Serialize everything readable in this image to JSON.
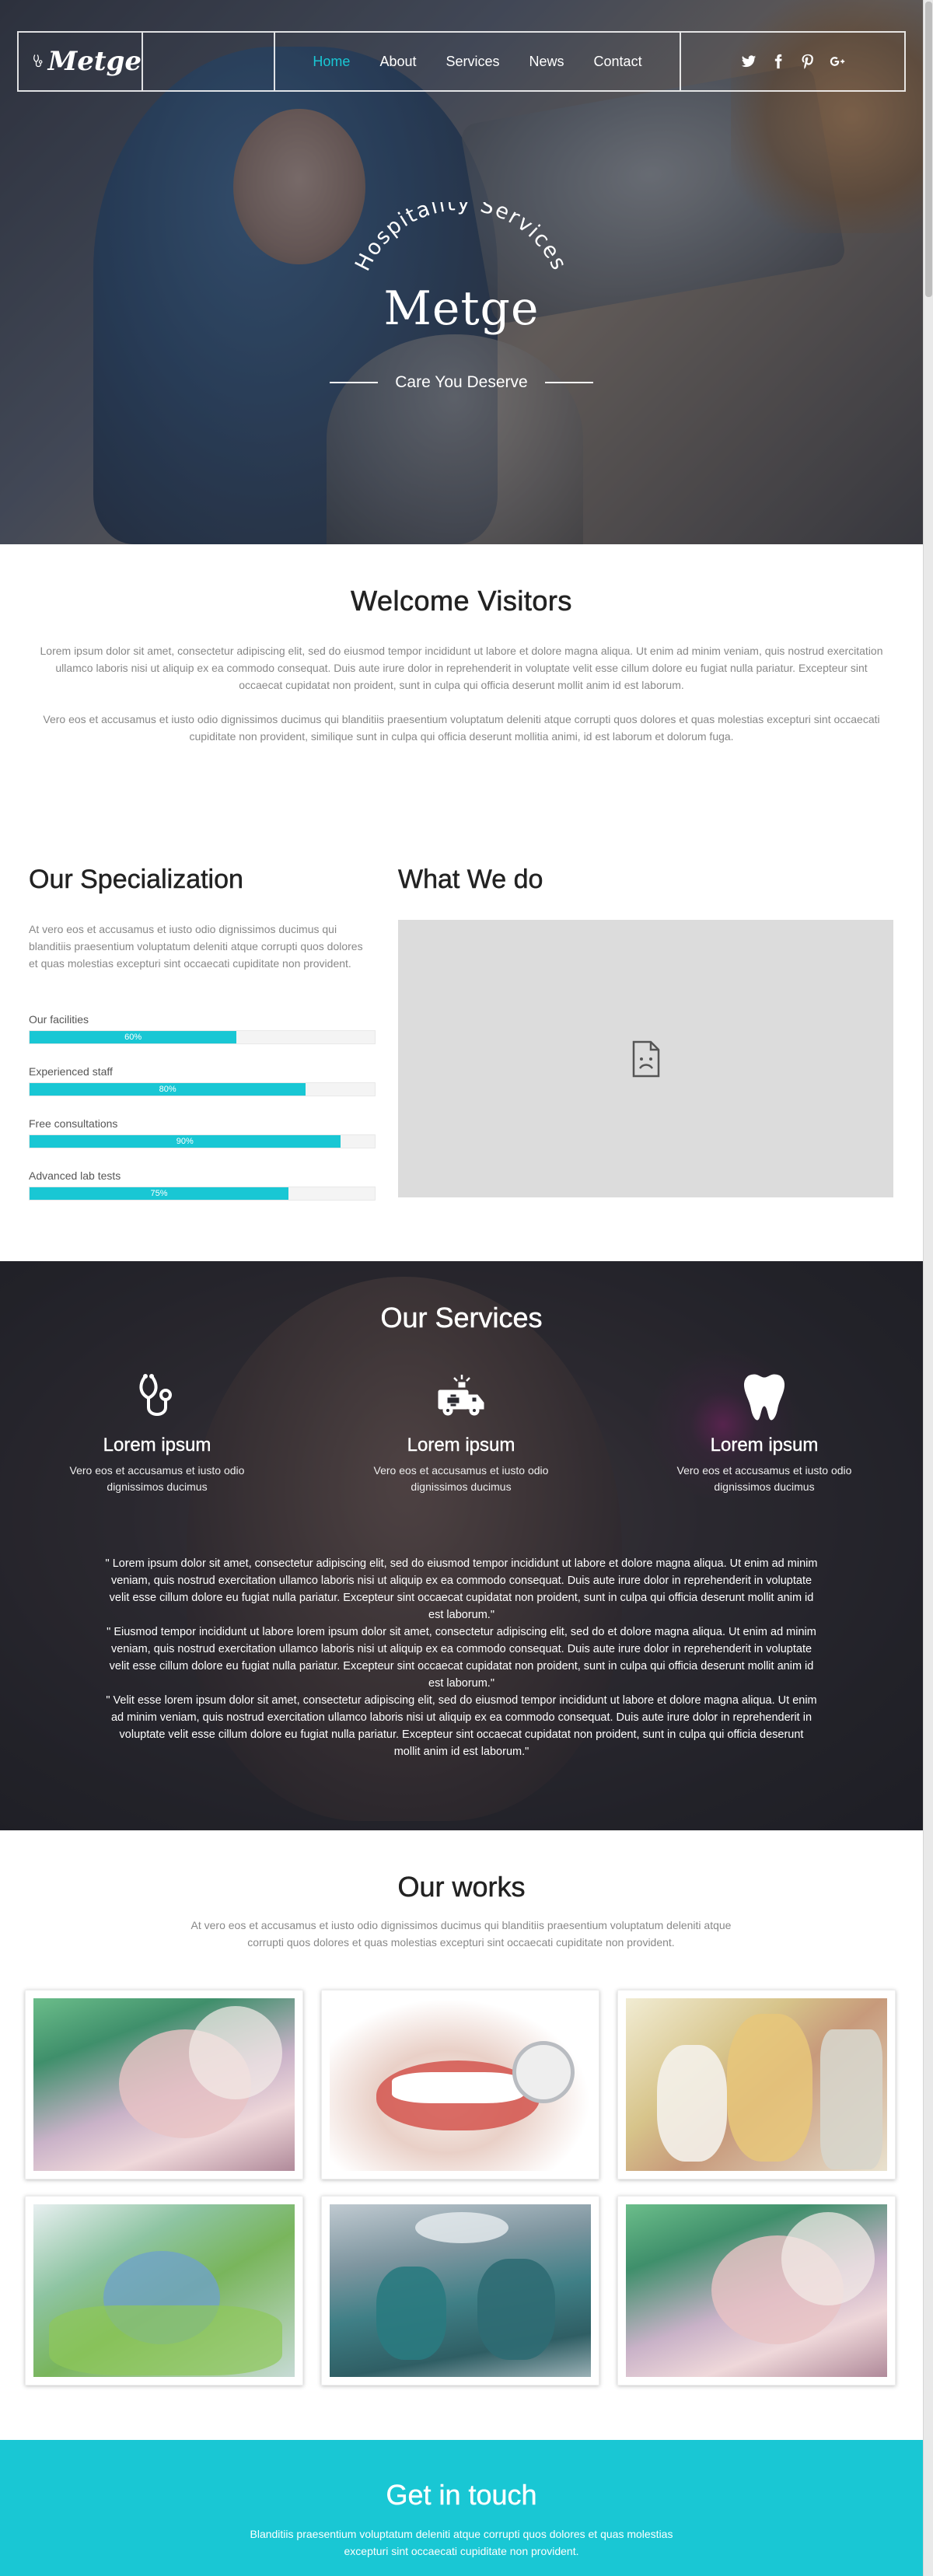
{
  "brand": {
    "logo_text": "Metge"
  },
  "nav": {
    "items": [
      {
        "label": "Home",
        "active": true
      },
      {
        "label": "About",
        "active": false
      },
      {
        "label": "Services",
        "active": false
      },
      {
        "label": "News",
        "active": false
      },
      {
        "label": "Contact",
        "active": false
      }
    ],
    "social": [
      "twitter-icon",
      "facebook-icon",
      "pinterest-icon",
      "google-plus-icon"
    ],
    "accent_color": "#19c7d4"
  },
  "hero": {
    "arc_text": "Hospitality Services",
    "title": "Metge",
    "tagline": "Care You Deserve"
  },
  "welcome": {
    "title": "Welcome Visitors",
    "p1": "Lorem ipsum dolor sit amet, consectetur adipiscing elit, sed do eiusmod tempor incididunt ut labore et dolore magna aliqua. Ut enim ad minim veniam, quis nostrud exercitation ullamco laboris nisi ut aliquip ex ea commodo consequat. Duis aute irure dolor in reprehenderit in voluptate velit esse cillum dolore eu fugiat nulla pariatur. Excepteur sint occaecat cupidatat non proident, sunt in culpa qui officia deserunt mollit anim id est laborum.",
    "p2": "Vero eos et accusamus et iusto odio dignissimos ducimus qui blanditiis praesentium voluptatum deleniti atque corrupti quos dolores et quas molestias excepturi sint occaecati cupiditate non provident, similique sunt in culpa qui officia deserunt mollitia animi, id est laborum et dolorum fuga."
  },
  "specialization": {
    "title": "Our Specialization",
    "intro": "At vero eos et accusamus et iusto odio dignissimos ducimus qui blanditiis praesentium voluptatum deleniti atque corrupti quos dolores et quas molestias excepturi sint occaecati cupiditate non provident.",
    "bars": [
      {
        "label": "Our facilities",
        "value": 60,
        "text": "60%"
      },
      {
        "label": "Experienced staff",
        "value": 80,
        "text": "80%"
      },
      {
        "label": "Free consultations",
        "value": 90,
        "text": "90%"
      },
      {
        "label": "Advanced lab tests",
        "value": 75,
        "text": "75%"
      }
    ]
  },
  "what_we_do": {
    "title": "What We do"
  },
  "services": {
    "title": "Our Services",
    "items": [
      {
        "icon": "stethoscope-icon",
        "title": "Lorem ipsum",
        "text": "Vero eos et accusamus et iusto odio dignissimos ducimus"
      },
      {
        "icon": "ambulance-icon",
        "title": "Lorem ipsum",
        "text": "Vero eos et accusamus et iusto odio dignissimos ducimus"
      },
      {
        "icon": "tooth-icon",
        "title": "Lorem ipsum",
        "text": "Vero eos et accusamus et iusto odio dignissimos ducimus"
      }
    ],
    "quotes": [
      "\" Lorem ipsum dolor sit amet, consectetur adipiscing elit, sed do eiusmod tempor incididunt ut labore et dolore magna aliqua. Ut enim ad minim veniam, quis nostrud exercitation ullamco laboris nisi ut aliquip ex ea commodo consequat. Duis aute irure dolor in reprehenderit in voluptate velit esse cillum dolore eu fugiat nulla pariatur. Excepteur sint occaecat cupidatat non proident, sunt in culpa qui officia deserunt mollit anim id est laborum.\"",
      "\" Eiusmod tempor incididunt ut labore lorem ipsum dolor sit amet, consectetur adipiscing elit, sed do et dolore magna aliqua. Ut enim ad minim veniam, quis nostrud exercitation ullamco laboris nisi ut aliquip ex ea commodo consequat. Duis aute irure dolor in reprehenderit in voluptate velit esse cillum dolore eu fugiat nulla pariatur. Excepteur sint occaecat cupidatat non proident, sunt in culpa qui officia deserunt mollit anim id est laborum.\"",
      "\" Velit esse lorem ipsum dolor sit amet, consectetur adipiscing elit, sed do eiusmod tempor incididunt ut labore et dolore magna aliqua. Ut enim ad minim veniam, quis nostrud exercitation ullamco laboris nisi ut aliquip ex ea commodo consequat. Duis aute irure dolor in reprehenderit in voluptate velit esse cillum dolore eu fugiat nulla pariatur. Excepteur sint occaecat cupidatat non proident, sunt in culpa qui officia deserunt mollit anim id est laborum.\""
    ]
  },
  "works": {
    "title": "Our works",
    "subtitle": "At vero eos et accusamus et iusto odio dignissimos ducimus qui blanditiis praesentium voluptatum deleniti atque corrupti quos dolores et quas molestias excepturi sint occaecati cupiditate non provident."
  },
  "contact": {
    "title": "Get in touch",
    "text": "Blanditiis praesentium voluptatum deleniti atque corrupti quos dolores et quas molestias excepturi sint occaecati cupiditate non provident."
  }
}
